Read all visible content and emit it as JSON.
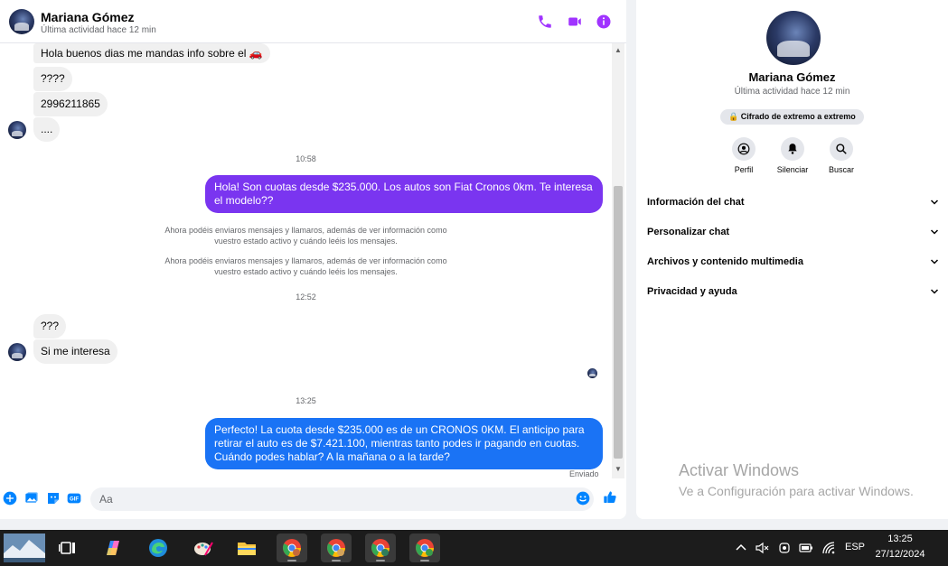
{
  "colors": {
    "accent": "#a033ff",
    "messenger_blue": "#0084ff",
    "outgoing_purple": "#8a2be2"
  },
  "header": {
    "name": "Mariana Gómez",
    "status": "Última actividad hace 12 min",
    "icons": [
      "phone-icon",
      "video-icon",
      "info-icon"
    ]
  },
  "messages": {
    "m1": "Hola buenos dias  me mandas info sobre el 🚗",
    "m2": "????",
    "m3": "2996211865",
    "m4": "....",
    "time1": "10:58",
    "m5": "Hola! Son cuotas desde $235.000. Los autos son Fiat Cronos 0km. Te interesa el modelo??",
    "notice1": "Ahora podéis enviaros mensajes y llamaros, además de ver información como vuestro estado activo y cuándo leéis los mensajes.",
    "notice2": "Ahora podéis enviaros mensajes y llamaros, además de ver información como vuestro estado activo y cuándo leéis los mensajes.",
    "time2": "12:52",
    "m6": "???",
    "m7": "Si me interesa",
    "time3": "13:25",
    "m8": "Perfecto! La cuota desde $235.000 es de un CRONOS 0KM. El anticipo para retirar el auto es de $7.421.100, mientras tanto podes ir pagando en cuotas. Cuándo podes hablar? A la mañana o a la tarde?",
    "sent_status": "Enviado"
  },
  "composer": {
    "placeholder": "Aa",
    "icons": [
      "plus-icon",
      "image-icon",
      "sticker-icon",
      "gif-icon",
      "emoji-icon",
      "like-icon"
    ]
  },
  "info_panel": {
    "name": "Mariana Gómez",
    "status": "Última actividad hace 12 min",
    "encryption": "🔒 Cifrado de extremo a extremo",
    "actions": [
      {
        "label": "Perfil",
        "icon": "profile-icon"
      },
      {
        "label": "Silenciar",
        "icon": "bell-icon"
      },
      {
        "label": "Buscar",
        "icon": "search-icon"
      }
    ],
    "sections": [
      "Información del chat",
      "Personalizar chat",
      "Archivos y contenido multimedia",
      "Privacidad y ayuda"
    ]
  },
  "watermark": {
    "title": "Activar Windows",
    "subtitle": "Ve a Configuración para activar Windows."
  },
  "taskbar": {
    "apps": [
      "start-icon",
      "task-view-icon",
      "copilot-icon",
      "edge-icon",
      "paint-icon",
      "file-explorer-icon",
      "chrome-icon",
      "chrome-icon",
      "chrome-icon",
      "chrome-icon"
    ],
    "language": "ESP",
    "time": "13:25",
    "date": "27/12/2024"
  }
}
